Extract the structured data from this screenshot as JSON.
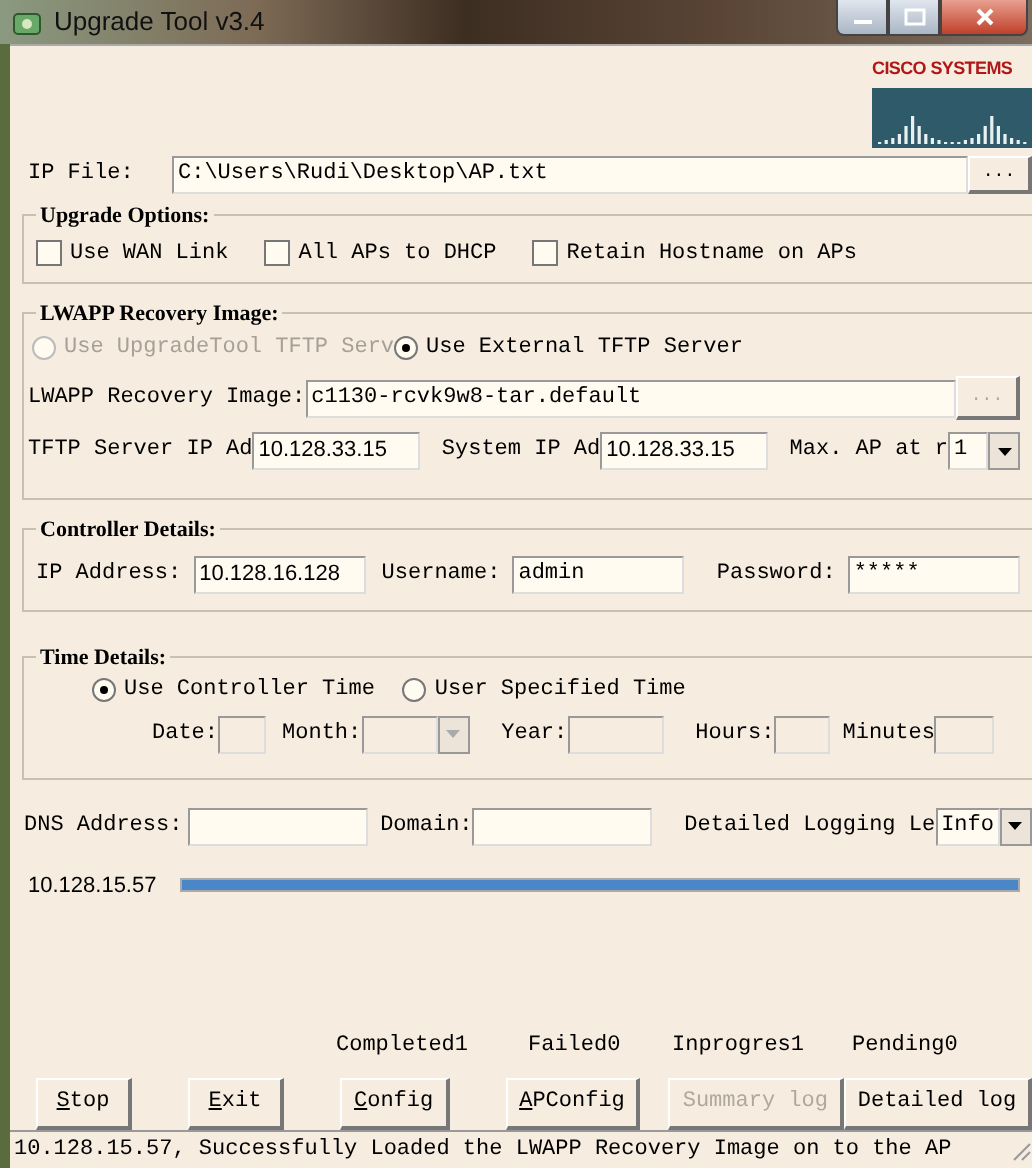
{
  "window": {
    "title": "Upgrade Tool v3.4"
  },
  "logo": {
    "text": "CISCO SYSTEMS"
  },
  "ip_file": {
    "label": "IP File:",
    "value": "C:\\Users\\Rudi\\Desktop\\AP.txt",
    "browse": "..."
  },
  "upgrade_options": {
    "title": "Upgrade Options:",
    "options": [
      {
        "label": "Use WAN Link",
        "checked": false
      },
      {
        "label": "All APs to DHCP",
        "checked": false
      },
      {
        "label": "Retain Hostname on APs",
        "checked": false
      }
    ]
  },
  "lwapp": {
    "title": "LWAPP Recovery Image:",
    "sources": [
      {
        "label": "Use UpgradeTool TFTP Serv",
        "selected": false,
        "disabled": true
      },
      {
        "label": "Use External TFTP Server",
        "selected": true,
        "disabled": false
      }
    ],
    "image": {
      "label": "LWAPP Recovery Image:",
      "value": "c1130-rcvk9w8-tar.default",
      "browse": "...",
      "browse_disabled": true
    },
    "tftp_ip": {
      "label": "TFTP Server IP Ad",
      "value": "10.128.33.15"
    },
    "system_ip": {
      "label": "System IP Ad",
      "value": "10.128.33.15"
    },
    "max_ap": {
      "label": "Max. AP at r",
      "value": "1"
    }
  },
  "controller": {
    "title": "Controller Details:",
    "fields": [
      {
        "label": "IP Address:",
        "value": "10.128.16.128"
      },
      {
        "label": "Username:",
        "value": "admin"
      },
      {
        "label": "Password:",
        "value": "*****"
      }
    ]
  },
  "time": {
    "title": "Time Details:",
    "disabled": true,
    "modes": [
      {
        "label": "Use Controller Time",
        "selected": true
      },
      {
        "label": "User Specified Time",
        "selected": false
      }
    ],
    "fields": [
      {
        "label": "Date:",
        "kind": "text"
      },
      {
        "label": "Month:",
        "kind": "dropdown"
      },
      {
        "label": "Year:",
        "kind": "text"
      },
      {
        "label": "Hours:",
        "kind": "text"
      },
      {
        "label": "Minutes",
        "kind": "text"
      }
    ]
  },
  "dns": {
    "label": "DNS Address:"
  },
  "domain": {
    "label": "Domain:"
  },
  "logging": {
    "label": "Detailed Logging Le",
    "value": "Info"
  },
  "progress": {
    "label": "10.128.15.57",
    "level": 1
  },
  "stats": [
    "Completed1",
    "Failed0",
    "Inprogres1",
    "Pending0"
  ],
  "buttons": [
    {
      "label": "Stop",
      "mnemonic": true,
      "disabled": false
    },
    {
      "label": "Exit",
      "mnemonic": true,
      "disabled": false
    },
    {
      "label": "Config",
      "mnemonic": true,
      "disabled": false
    },
    {
      "label": "APConfig",
      "mnemonic": true,
      "disabled": false
    },
    {
      "label": "Summary log",
      "mnemonic": false,
      "disabled": true
    },
    {
      "label": "Detailed log",
      "mnemonic": false,
      "disabled": false
    }
  ],
  "status_bar": "10.128.15.57, Successfully Loaded the LWAPP Recovery Image on to the AP"
}
